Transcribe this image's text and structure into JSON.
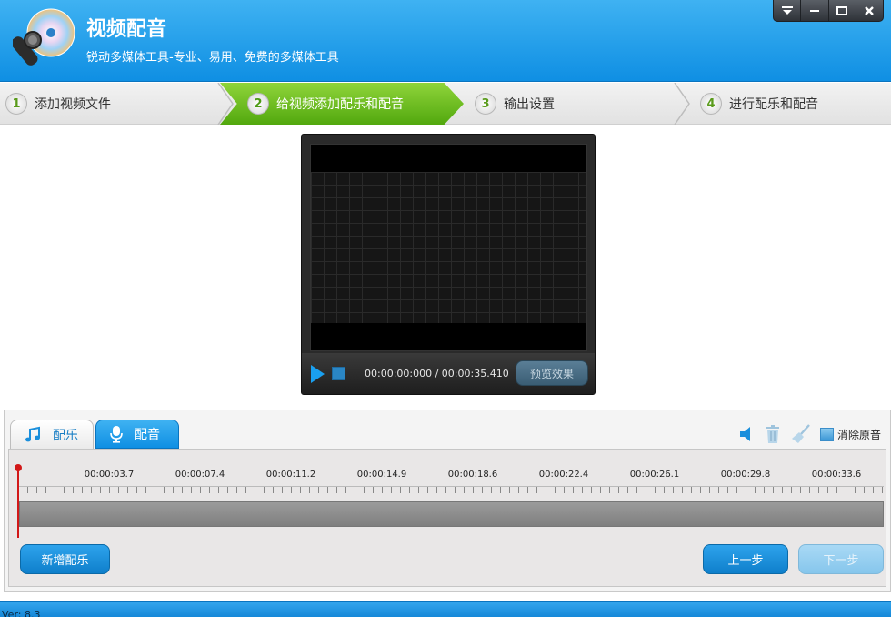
{
  "app": {
    "title": "视频配音",
    "subtitle": "锐动多媒体工具-专业、易用、免费的多媒体工具"
  },
  "window_controls": [
    "dropdown-icon",
    "minimize-icon",
    "maximize-icon",
    "close-icon"
  ],
  "steps": [
    {
      "num": "1",
      "label": "添加视频文件",
      "active": false
    },
    {
      "num": "2",
      "label": "给视频添加配乐和配音",
      "active": true
    },
    {
      "num": "3",
      "label": "输出设置",
      "active": false
    },
    {
      "num": "4",
      "label": "进行配乐和配音",
      "active": false
    }
  ],
  "player": {
    "timecode": "00:00:00:000 / 00:00:35.410",
    "preview_label": "预览效果"
  },
  "tabs": {
    "music": "配乐",
    "voice": "配音"
  },
  "tools": {
    "mute_original_label": "消除原音"
  },
  "timeline": {
    "ticks": [
      "00:00:03.7",
      "00:00:07.4",
      "00:00:11.2",
      "00:00:14.9",
      "00:00:18.6",
      "00:00:22.4",
      "00:00:26.1",
      "00:00:29.8",
      "00:00:33.6"
    ]
  },
  "buttons": {
    "add_music": "新增配乐",
    "prev": "上一步",
    "next": "下一步"
  },
  "footer": {
    "version": "Ver: 8.3"
  },
  "colors": {
    "header_blue": "#1a9be8",
    "step_active_green": "#6cbf22",
    "button_blue": "#1a8fdc",
    "playhead_red": "#d21818"
  }
}
